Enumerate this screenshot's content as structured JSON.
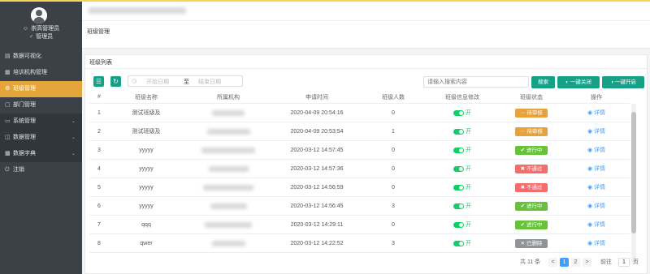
{
  "colors": {
    "accent": "#16a085",
    "active_menu": "#e4a63a",
    "sidebar": "#3b4147",
    "pending": "#e6a23c",
    "running": "#67c23a",
    "rejected": "#f56c6c",
    "deleted": "#909399",
    "link": "#409eff"
  },
  "user": {
    "name": "崇高管理员",
    "role": "管理员"
  },
  "sidebar": {
    "items": [
      {
        "label": "数据可视化",
        "icon": "bar-chart-icon"
      },
      {
        "label": "培训机构管理",
        "icon": "building-icon"
      },
      {
        "label": "班级管理",
        "icon": "gear-icon"
      },
      {
        "label": "部门管理",
        "icon": "folder-icon"
      },
      {
        "label": "系统管理",
        "icon": "monitor-icon"
      },
      {
        "label": "数据管理",
        "icon": "database-icon"
      },
      {
        "label": "数据字典",
        "icon": "book-icon"
      },
      {
        "label": "注销",
        "icon": "power-icon"
      }
    ]
  },
  "header": {
    "title": "班级管理"
  },
  "list": {
    "title": "班级列表",
    "date_start_placeholder": "开始日期",
    "date_sep": "至",
    "date_end_placeholder": "结束日期",
    "search_placeholder": "请输入搜索内容",
    "search_btn": "搜索",
    "close_all_btn": "一键关闭",
    "open_all_btn": "一键开启"
  },
  "table": {
    "columns": [
      "#",
      "班级名称",
      "所属机构",
      "申请时间",
      "班级人数",
      "班级信息修改",
      "班级状态",
      "操作"
    ],
    "rows": [
      {
        "no": "1",
        "name": "测试班级及",
        "org": "",
        "time": "2020-04-09 20:54:16",
        "count": "0",
        "edit": "开",
        "status": "待审核",
        "action": "详情"
      },
      {
        "no": "2",
        "name": "测试班级及",
        "org": "",
        "time": "2020-04-09 20:53:54",
        "count": "1",
        "edit": "开",
        "status": "待审核",
        "action": "详情"
      },
      {
        "no": "3",
        "name": "yyyyy",
        "org": "",
        "time": "2020-03-12 14:57:45",
        "count": "0",
        "edit": "开",
        "status": "进行中",
        "action": "详情"
      },
      {
        "no": "4",
        "name": "yyyyy",
        "org": "",
        "time": "2020-03-12 14:57:36",
        "count": "0",
        "edit": "开",
        "status": "不通过",
        "action": "详情"
      },
      {
        "no": "5",
        "name": "yyyyy",
        "org": "",
        "time": "2020-03-12 14:56:59",
        "count": "0",
        "edit": "开",
        "status": "不通过",
        "action": "详情"
      },
      {
        "no": "6",
        "name": "yyyyy",
        "org": "",
        "time": "2020-03-12 14:56:45",
        "count": "3",
        "edit": "开",
        "status": "进行中",
        "action": "详情"
      },
      {
        "no": "7",
        "name": "qqq",
        "org": "",
        "time": "2020-03-12 14:29:11",
        "count": "0",
        "edit": "开",
        "status": "进行中",
        "action": "详情"
      },
      {
        "no": "8",
        "name": "qwer",
        "org": "",
        "time": "2020-03-12 14:22:52",
        "count": "3",
        "edit": "开",
        "status": "已删除",
        "action": "详情"
      }
    ]
  },
  "pagination": {
    "total": "共 11 条",
    "prev": "<",
    "page1": "1",
    "page2": "2",
    "next": ">",
    "goto": "前往",
    "goto_value": "1",
    "page_unit": "页"
  }
}
